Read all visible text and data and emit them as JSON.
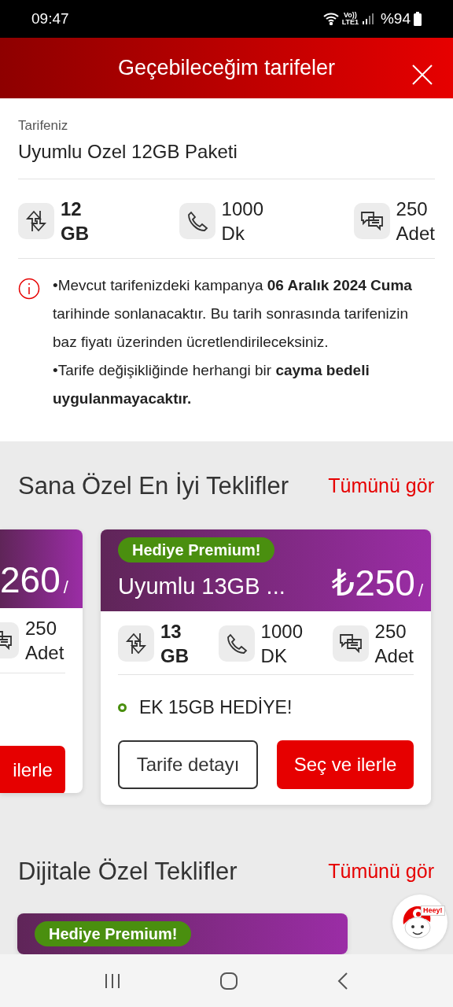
{
  "status_bar": {
    "time": "09:47",
    "volte": "Vo))",
    "network": "LTE1",
    "battery": "%94"
  },
  "header": {
    "title": "Geçebileceğim tarifeler"
  },
  "current_tariff": {
    "label": "Tarifeniz",
    "name": "Uyumlu Ozel 12GB Paketi",
    "stats": [
      {
        "kind": "data",
        "value": "12",
        "unit": "GB",
        "bold": true
      },
      {
        "kind": "voice",
        "value": "1000",
        "unit": "Dk",
        "bold": false
      },
      {
        "kind": "sms",
        "value": "250",
        "unit": "Adet",
        "bold": false
      }
    ]
  },
  "notice": {
    "lines": [
      "•Mevcut tarifenizdeki kampanya **06 Aralık 2024 Cuma** tarihinde sonlanacaktır. Bu tarih sonrasında tarifenizin baz fiyatı üzerinden ücretlendirileceksiniz.",
      "•Tarife değişikliğinde herhangi bir **cayma bedeli uygulanmayacaktır.**"
    ]
  },
  "sections": [
    {
      "title": "Sana Özel En İyi Teklifler",
      "link": "Tümünü gör",
      "cards": [
        {
          "partial": true,
          "price": "260",
          "per": "/",
          "stats": [
            {
              "kind": "sms",
              "value": "250",
              "unit": "Adet",
              "bold": false
            }
          ],
          "buttons": [
            {
              "kind": "primary",
              "label": "ilerle"
            }
          ]
        },
        {
          "partial": false,
          "badge": "Hediye Premium!",
          "name": "Uyumlu 13GB ...",
          "price": "₺250",
          "per": "/",
          "stats": [
            {
              "kind": "data",
              "value": "13",
              "unit": "GB",
              "bold": true
            },
            {
              "kind": "voice",
              "value": "1000",
              "unit": "DK",
              "bold": false
            },
            {
              "kind": "sms",
              "value": "250",
              "unit": "Adet",
              "bold": false
            }
          ],
          "features": [
            "EK 15GB HEDİYE!"
          ],
          "buttons": [
            {
              "kind": "outline",
              "label": "Tarife detayı"
            },
            {
              "kind": "primary",
              "label": "Seç ve ilerle"
            }
          ]
        }
      ]
    },
    {
      "title": "Dijitale Özel Teklifler",
      "link": "Tümünü gör",
      "cards": [
        {
          "partial": false,
          "badge": "Hediye Premium!"
        }
      ]
    }
  ],
  "chat_bubble": {
    "sign": "Heey!"
  }
}
